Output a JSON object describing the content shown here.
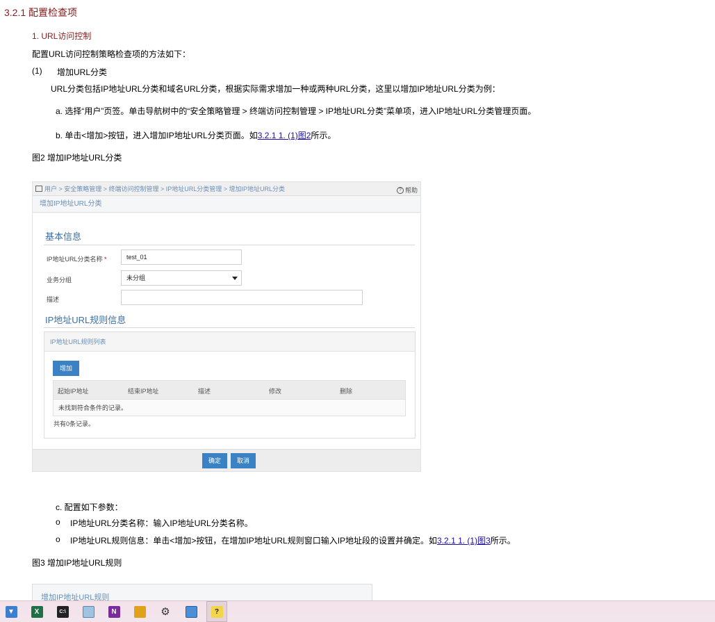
{
  "doc": {
    "section_heading": "3.2.1  配置检查项",
    "sub_heading": "1. URL访问控制",
    "intro": "配置URL访问控制策略检查项的方法如下：",
    "step1_num": "(1)",
    "step1_title": "增加URL分类",
    "step1_desc": "URL分类包括IP地址URL分类和域名URL分类，根据实际需求增加一种或两种URL分类，这里以增加IP地址URL分类为例：",
    "step_a": "a.  选择“用户”页签。单击导航树中的“安全策略管理 > 终端访问控制管理 > IP地址URL分类”菜单项，进入IP地址URL分类管理页面。",
    "step_b_prefix": "b.  单击<增加>按钮，进入增加IP地址URL分类页面。如",
    "step_b_link": "3.2.1  1. (1)图2",
    "step_b_suffix": "所示。",
    "fig2_caption": "图2 增加IP地址URL分类",
    "step_c": "c.  配置如下参数：",
    "bullet1": "IP地址URL分类名称：输入IP地址URL分类名称。",
    "bullet2_prefix": "IP地址URL规则信息：单击<增加>按钮，在增加IP地址URL规则窗口输入IP地址段的设置并确定。如",
    "bullet2_link": "3.2.1  1. (1)图3",
    "bullet2_suffix": "所示。",
    "bullet_mark": "o",
    "fig3_caption": "图3 增加IP地址URL规则"
  },
  "screenshot": {
    "breadcrumb": "用户 > 安全策略管理 > 终端访问控制管理 > IP地址URL分类管理 > 增加IP地址URL分类",
    "help": "帮助",
    "tab": "增加IP地址URL分类",
    "basic_info_title": "基本信息",
    "name_label": "IP地址URL分类名称",
    "required_mark": "*",
    "name_value": "test_01",
    "group_label": "业务分组",
    "group_value": "未分组",
    "desc_label": "描述",
    "rule_info_title": "IP地址URL规则信息",
    "rule_list_title": "IP地址URL规则列表",
    "add_button": "增加",
    "columns": [
      "起始IP地址",
      "结束IP地址",
      "描述",
      "修改",
      "删除"
    ],
    "empty_row": "未找到符合条件的记录。",
    "count_text": "共有0条记录。",
    "ok_button": "确定",
    "cancel_button": "取消"
  },
  "screenshot3": {
    "title": "增加IP地址URL规则"
  },
  "taskbar": {
    "icons": [
      "start-icon",
      "excel-icon",
      "cmd-icon",
      "notepad-icon",
      "onenote-icon",
      "explorer-icon",
      "settings-icon",
      "remote-desktop-icon",
      "help-icon"
    ],
    "colors": {
      "excel": "#1e7145",
      "cmd": "#222222",
      "onenote": "#7a2b9c",
      "explorer": "#e0a21a",
      "start": "#3c7fd1"
    }
  }
}
